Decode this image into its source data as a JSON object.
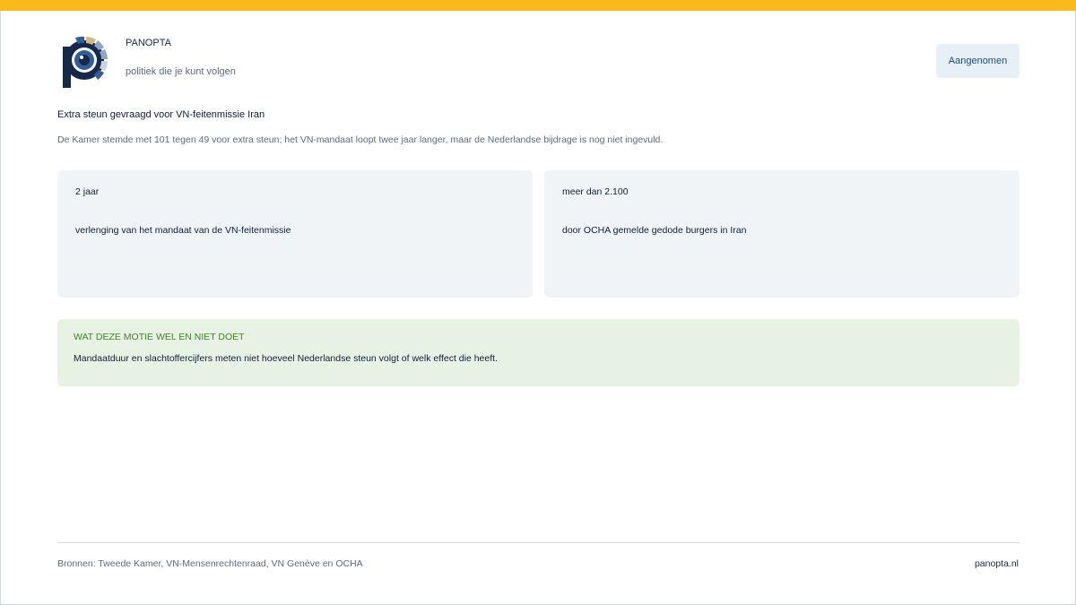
{
  "brand": {
    "name": "PANOPTA",
    "tagline": "politiek die je kunt volgen",
    "colors": {
      "accent": "#fbb91b",
      "navy": "#15294b",
      "logo_blue": "#2e5f9c",
      "logo_tan": "#d9b77c",
      "logo_grey": "#8fa6c2"
    }
  },
  "status": {
    "label": "Aangenomen"
  },
  "motion": {
    "title": "Extra steun gevraagd voor VN-feitenmissie Iran",
    "summary": "De Kamer stemde met 101 tegen 49 voor extra steun; het VN-mandaat loopt twee jaar langer, maar de Nederlandse bijdrage is nog niet ingevuld."
  },
  "stats": [
    {
      "value": "2 jaar",
      "description": "verlenging van het mandaat van de VN-feitenmissie"
    },
    {
      "value": "meer dan 2.100",
      "description": "door OCHA gemelde gedode burgers in Iran"
    }
  ],
  "note": {
    "heading": "WAT DEZE MOTIE WEL EN NIET DOET",
    "text": "Mandaatduur en slachtoffercijfers meten niet hoeveel Nederlandse steun volgt of welk effect die heeft."
  },
  "footer": {
    "sources": "Bronnen: Tweede Kamer, VN-Mensenrechtenraad, VN Genève en OCHA",
    "site": "panopta.nl"
  }
}
